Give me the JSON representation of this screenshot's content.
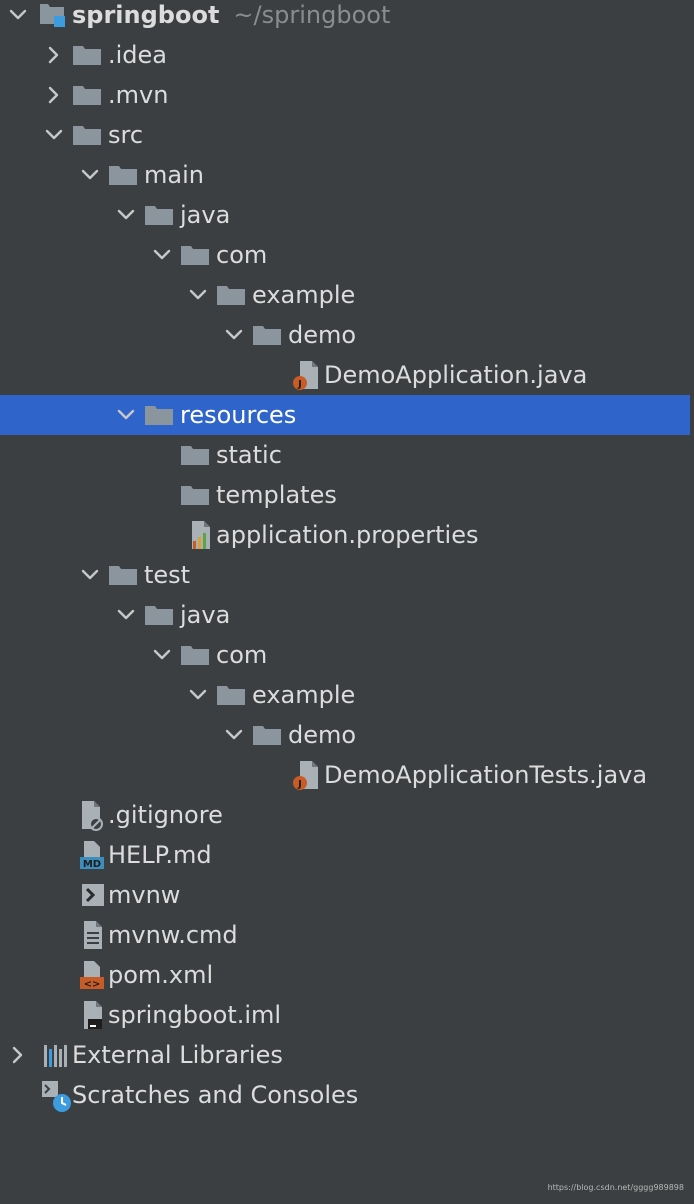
{
  "project": {
    "name": "springboot",
    "path": "~/springboot"
  },
  "tree": {
    "idea": ".idea",
    "mvn": ".mvn",
    "src": "src",
    "main": "main",
    "main_java": "java",
    "main_com": "com",
    "main_example": "example",
    "main_demo": "demo",
    "demo_application": "DemoApplication.java",
    "resources": "resources",
    "static": "static",
    "templates": "templates",
    "application_properties": "application.properties",
    "test": "test",
    "test_java": "java",
    "test_com": "com",
    "test_example": "example",
    "test_demo": "demo",
    "demo_application_tests": "DemoApplicationTests.java",
    "gitignore": ".gitignore",
    "help_md": "HELP.md",
    "mvnw": "mvnw",
    "mvnw_cmd": "mvnw.cmd",
    "pom_xml": "pom.xml",
    "springboot_iml": "springboot.iml",
    "external_libraries": "External Libraries",
    "scratches": "Scratches and Consoles"
  },
  "colors": {
    "background": "#3c3f41",
    "selection": "#2f65ca",
    "folder": "#8b959e",
    "java_badge": "#c75c26",
    "md_badge": "#3d8dbd",
    "xml_badge": "#c75c26"
  },
  "watermark": "https://blog.csdn.net/gggg989898"
}
